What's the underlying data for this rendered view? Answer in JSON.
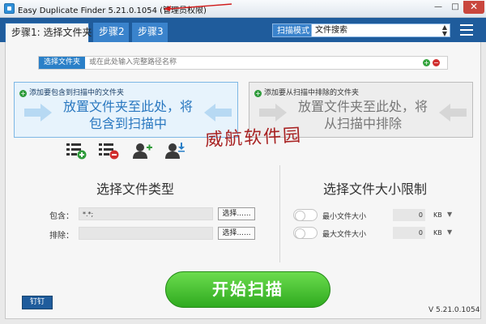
{
  "window": {
    "title": "Easy Duplicate Finder 5.21.0.1054 (管理员权限)",
    "min": "—",
    "max": "□",
    "close": "✕"
  },
  "tabs": [
    "步骤1: 选择文件夹",
    "步骤2",
    "步骤3"
  ],
  "scan_mode": {
    "label": "扫描模式",
    "value": "文件搜索"
  },
  "path": {
    "button": "选择文件夹",
    "placeholder": "或在此处输入完整路径名称",
    "add": "+",
    "remove": "−"
  },
  "include_zone": {
    "header": "添加要包含到扫描中的文件夹",
    "line1": "放置文件夹至此处，将",
    "line2": "包含到扫描中",
    "icon": "+"
  },
  "exclude_zone": {
    "header": "添加要从扫描中排除的文件夹",
    "line1": "放置文件夹至此处，将",
    "line2": "从扫描中排除",
    "icon": "+"
  },
  "watermark": "威航软件园",
  "file_types": {
    "title": "选择文件类型",
    "include_label": "包含：",
    "include_value": "*.*;",
    "exclude_label": "排除：",
    "exclude_value": "",
    "choose": "选择......"
  },
  "size_limit": {
    "title": "选择文件大小限制",
    "min_label": "最小文件大小",
    "min_value": "0",
    "max_label": "最大文件大小",
    "max_value": "0",
    "unit": "KB",
    "caret": "▼"
  },
  "start_button": "开始扫描",
  "pin_button": "钉钉",
  "version": "V 5.21.0.1054",
  "colors": {
    "header_blue": "#1f5c9c",
    "accent_blue": "#2b80c8",
    "start_green": "#3fbf2c",
    "remove_red": "#d02d2d"
  }
}
